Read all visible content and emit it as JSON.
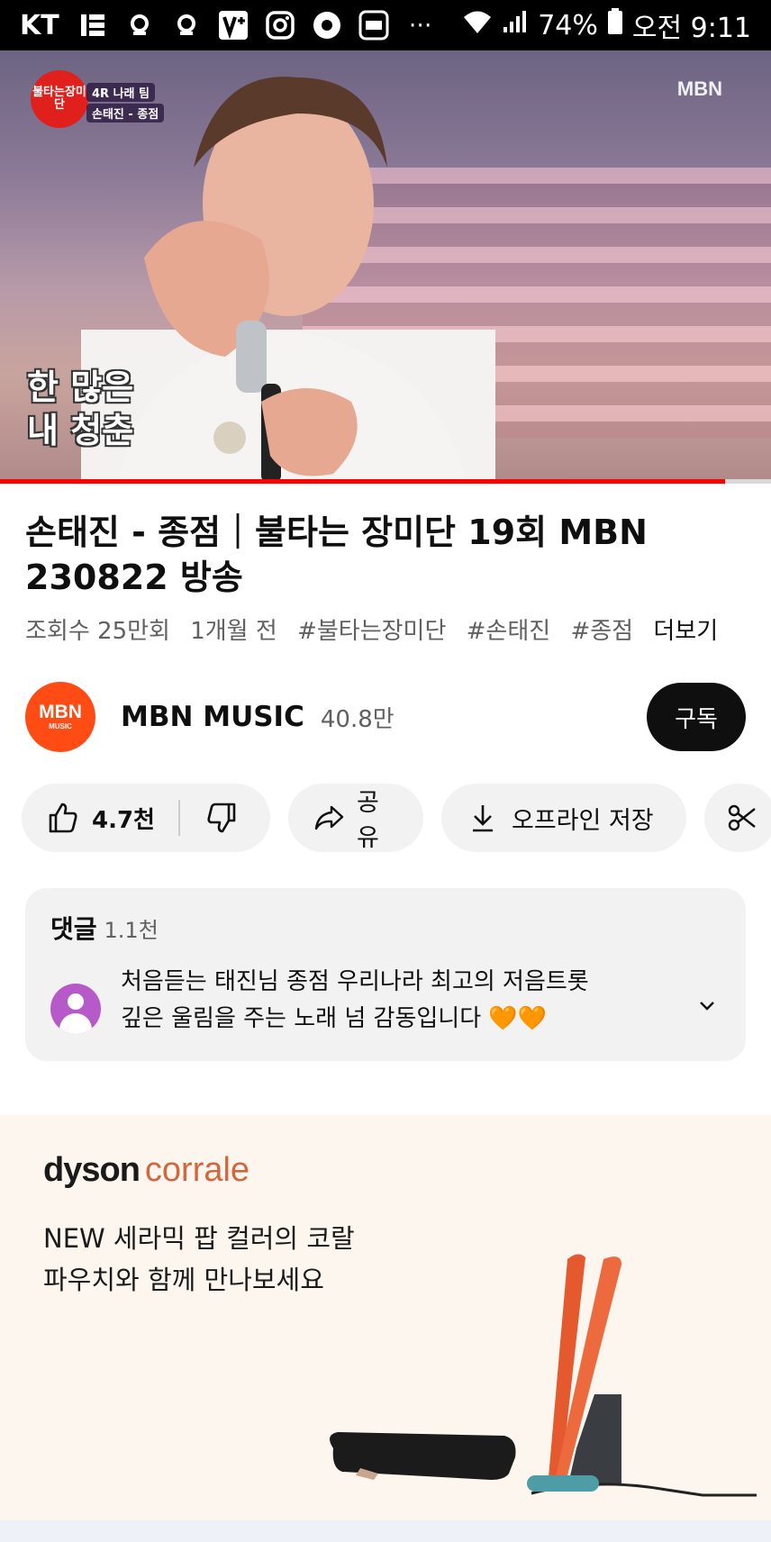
{
  "status_bar": {
    "carrier": "KT",
    "battery": "74%",
    "time": "오전 9:11"
  },
  "video": {
    "show_logo_text": "불타는장미단",
    "show_tag_line1": "4R 나래 팀",
    "show_tag_line2": "손태진 - 종점",
    "watermark": "MBN",
    "caption_line1": "한 많은",
    "caption_line2": "내 청춘",
    "progress_percent": 94
  },
  "title": "손태진 - 종점｜불타는 장미단 19회 MBN 230822 방송",
  "meta": {
    "views": "조회수 25만회",
    "age": "1개월 전",
    "tags": [
      "#불타는장미단",
      "#손태진",
      "#종점"
    ],
    "more": "더보기"
  },
  "channel": {
    "avatar_line1": "MBN",
    "avatar_line2": "MUSIC",
    "name": "MBN MUSIC",
    "subscribers": "40.8만",
    "subscribe_label": "구독"
  },
  "actions": {
    "like_count": "4.7천",
    "share_label": "공유",
    "download_label": "오프라인 저장"
  },
  "comments": {
    "label": "댓글",
    "count": "1.1천",
    "top_comment_line1": "처음듣는 태진님 종점 우리나라 최고의 저음트롯",
    "top_comment_line2": "깊은 울림을 주는 노래  넘 감동입니다 🧡🧡"
  },
  "ad": {
    "brand": "dyson",
    "product": "corrale",
    "copy_line1": "NEW 세라믹 팝 컬러의 코랄",
    "copy_line2": "파우치와 함께 만나보세요"
  },
  "colors": {
    "progress": "#ff0000",
    "subscribe_bg": "#0f0f0f",
    "chip_bg": "#f2f2f2",
    "ad_bg": "#fcf6ee",
    "brand_accent": "#d2673d"
  }
}
